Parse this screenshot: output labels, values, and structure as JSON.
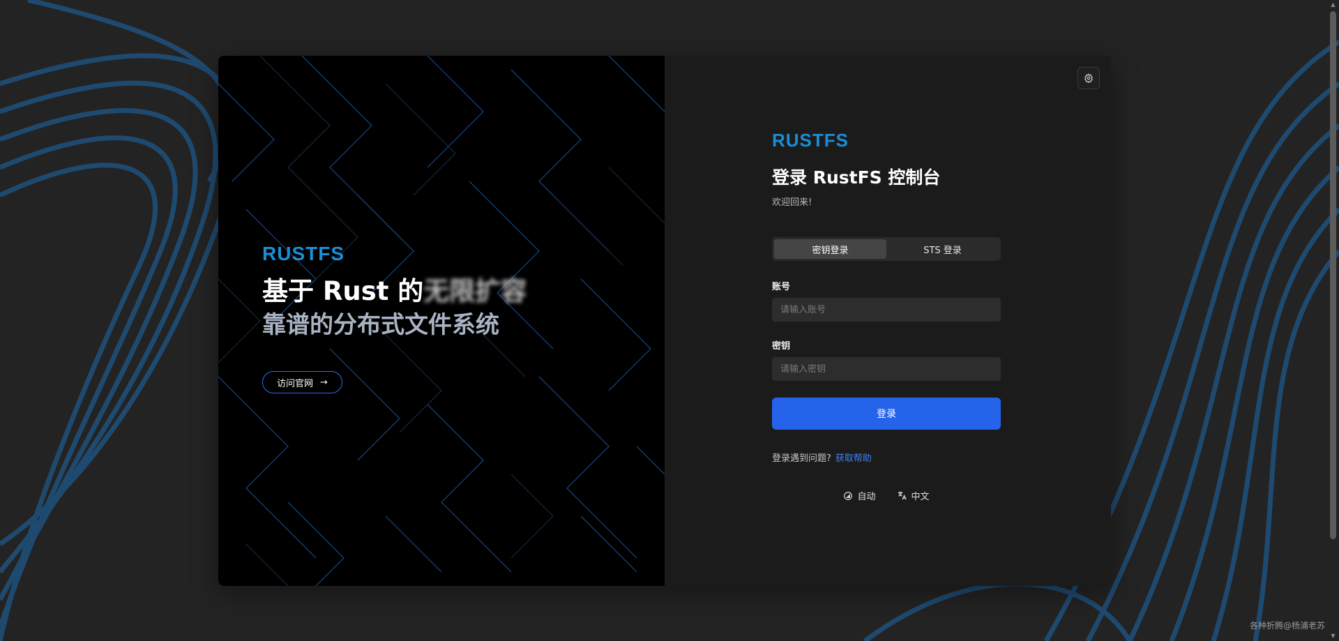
{
  "left": {
    "logo": "RUSTFS",
    "headline_line1": "基于 Rust 的",
    "headline_line1_blurred": "无限扩容",
    "headline_line2": "靠谱的分布式文件系统",
    "visit_button": "访问官网"
  },
  "right": {
    "logo": "RUSTFS",
    "title": "登录 RustFS 控制台",
    "subtitle": "欢迎回来!",
    "tabs": [
      {
        "label": "密钥登录",
        "active": true
      },
      {
        "label": "STS 登录",
        "active": false
      }
    ],
    "account_label": "账号",
    "account_placeholder": "请输入账号",
    "secret_label": "密钥",
    "secret_placeholder": "请输入密钥",
    "login_button": "登录",
    "help_text": "登录遇到问题?",
    "help_link": "获取帮助",
    "theme_option": "自动",
    "language_option": "中文"
  },
  "watermark": "各种折腾@杨浦老苏",
  "colors": {
    "accent": "#2563eb",
    "logo": "#1a8fd6",
    "background": "#232323"
  }
}
